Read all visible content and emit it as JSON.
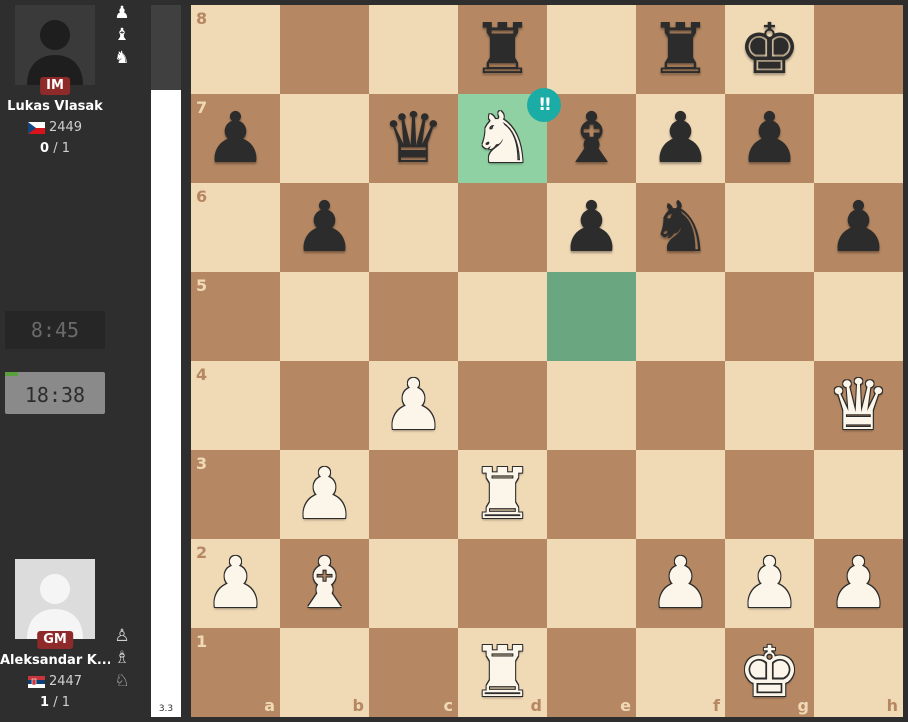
{
  "top_player": {
    "title": "IM",
    "name": "Lukas Vlasak",
    "rating": "2449",
    "score_main": "0",
    "score_rest": " / 1",
    "flag": "czech",
    "material_icons": [
      "two-pawns-icon",
      "bishop-icon",
      "knight-icon"
    ]
  },
  "bottom_player": {
    "title": "GM",
    "name": "Aleksandar K...",
    "rating": "2447",
    "score_main": "1",
    "score_rest": " / 1",
    "flag": "serbia",
    "material_icons": [
      "two-pawns-icon",
      "bishop-icon",
      "knight-icon"
    ]
  },
  "clocks": {
    "top": "8:45",
    "bottom": "18:38",
    "bottom_progress_fraction": 0.13
  },
  "eval": {
    "value": "3.3",
    "black_fraction": 0.12
  },
  "board": {
    "light_color": "#f0d9b5",
    "dark_color": "#b58863",
    "highlight_squares": [
      "d7",
      "e5"
    ],
    "brilliant_square": "d7",
    "brilliant_label": "!!",
    "rank_labels": [
      "8",
      "7",
      "6",
      "5",
      "4",
      "3",
      "2",
      "1"
    ],
    "file_labels": [
      "a",
      "b",
      "c",
      "d",
      "e",
      "f",
      "g",
      "h"
    ],
    "pieces": [
      {
        "sq": "d8",
        "glyph": "♜",
        "color": "b",
        "name": "black-rook"
      },
      {
        "sq": "f8",
        "glyph": "♜",
        "color": "b",
        "name": "black-rook"
      },
      {
        "sq": "g8",
        "glyph": "♚",
        "color": "b",
        "name": "black-king"
      },
      {
        "sq": "a7",
        "glyph": "♟",
        "color": "b",
        "name": "black-pawn"
      },
      {
        "sq": "c7",
        "glyph": "♛",
        "color": "b",
        "name": "black-queen"
      },
      {
        "sq": "d7",
        "glyph": "♞",
        "color": "w",
        "name": "white-knight"
      },
      {
        "sq": "e7",
        "glyph": "♝",
        "color": "b",
        "name": "black-bishop"
      },
      {
        "sq": "f7",
        "glyph": "♟",
        "color": "b",
        "name": "black-pawn"
      },
      {
        "sq": "g7",
        "glyph": "♟",
        "color": "b",
        "name": "black-pawn"
      },
      {
        "sq": "b6",
        "glyph": "♟",
        "color": "b",
        "name": "black-pawn"
      },
      {
        "sq": "e6",
        "glyph": "♟",
        "color": "b",
        "name": "black-pawn"
      },
      {
        "sq": "f6",
        "glyph": "♞",
        "color": "b",
        "name": "black-knight"
      },
      {
        "sq": "h6",
        "glyph": "♟",
        "color": "b",
        "name": "black-pawn"
      },
      {
        "sq": "c4",
        "glyph": "♟",
        "color": "w",
        "name": "white-pawn"
      },
      {
        "sq": "h4",
        "glyph": "♛",
        "color": "w",
        "name": "white-queen"
      },
      {
        "sq": "b3",
        "glyph": "♟",
        "color": "w",
        "name": "white-pawn"
      },
      {
        "sq": "d3",
        "glyph": "♜",
        "color": "w",
        "name": "white-rook"
      },
      {
        "sq": "a2",
        "glyph": "♟",
        "color": "w",
        "name": "white-pawn"
      },
      {
        "sq": "b2",
        "glyph": "♝",
        "color": "w",
        "name": "white-bishop"
      },
      {
        "sq": "f2",
        "glyph": "♟",
        "color": "w",
        "name": "white-pawn"
      },
      {
        "sq": "g2",
        "glyph": "♟",
        "color": "w",
        "name": "white-pawn"
      },
      {
        "sq": "h2",
        "glyph": "♟",
        "color": "w",
        "name": "white-pawn"
      },
      {
        "sq": "d1",
        "glyph": "♜",
        "color": "w",
        "name": "white-rook"
      },
      {
        "sq": "g1",
        "glyph": "♚",
        "color": "w",
        "name": "white-king"
      }
    ]
  }
}
